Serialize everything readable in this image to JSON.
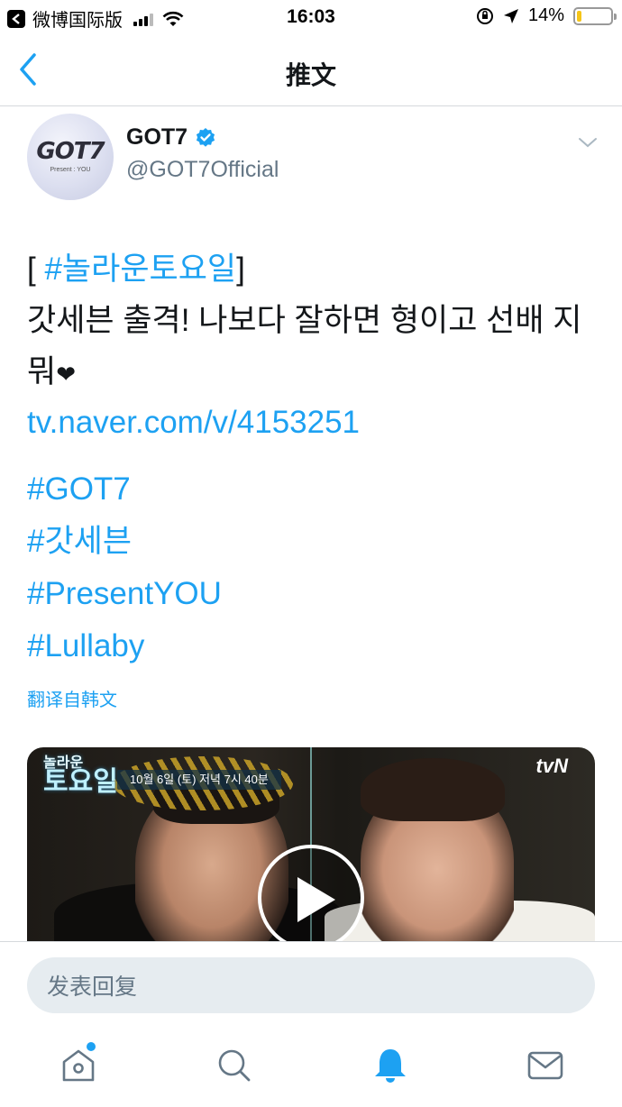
{
  "status_bar": {
    "carrier": "微博国际版",
    "time": "16:03",
    "battery_percent": "14%",
    "battery_level": 0.14
  },
  "nav": {
    "title": "推文",
    "back_icon": "chevron-left-icon"
  },
  "tweet": {
    "display_name": "GOT7",
    "handle": "@GOT7Official",
    "avatar_logo": "GOT7",
    "avatar_subtext": "Present : YOU",
    "body": {
      "open_bracket": "[ ",
      "hashtag_first": "#놀라운토요일",
      "close_bracket": "]",
      "text": "갓세븐 출격! 나보다 잘하면 형이고 선배 지뭐",
      "heart": "❤"
    },
    "url": "tv.naver.com/v/4153251",
    "hashtags": [
      "#GOT7",
      "#갓세븐",
      "#PresentYOU",
      "#Lullaby"
    ],
    "translate_label": "翻译自韩文",
    "video": {
      "show_title_small": "놀라운",
      "show_title_large": "토요일",
      "airtime": "10월 6일 (토) 저녁 7시 40분",
      "channel": "tvN"
    }
  },
  "reply": {
    "placeholder": "发表回复"
  },
  "tab_bar": {
    "items": [
      "home-icon",
      "search-icon",
      "notifications-icon",
      "messages-icon"
    ]
  },
  "colors": {
    "accent": "#1da1f2",
    "text": "#14171a",
    "secondary": "#657786",
    "input_bg": "#e6ecf0"
  }
}
